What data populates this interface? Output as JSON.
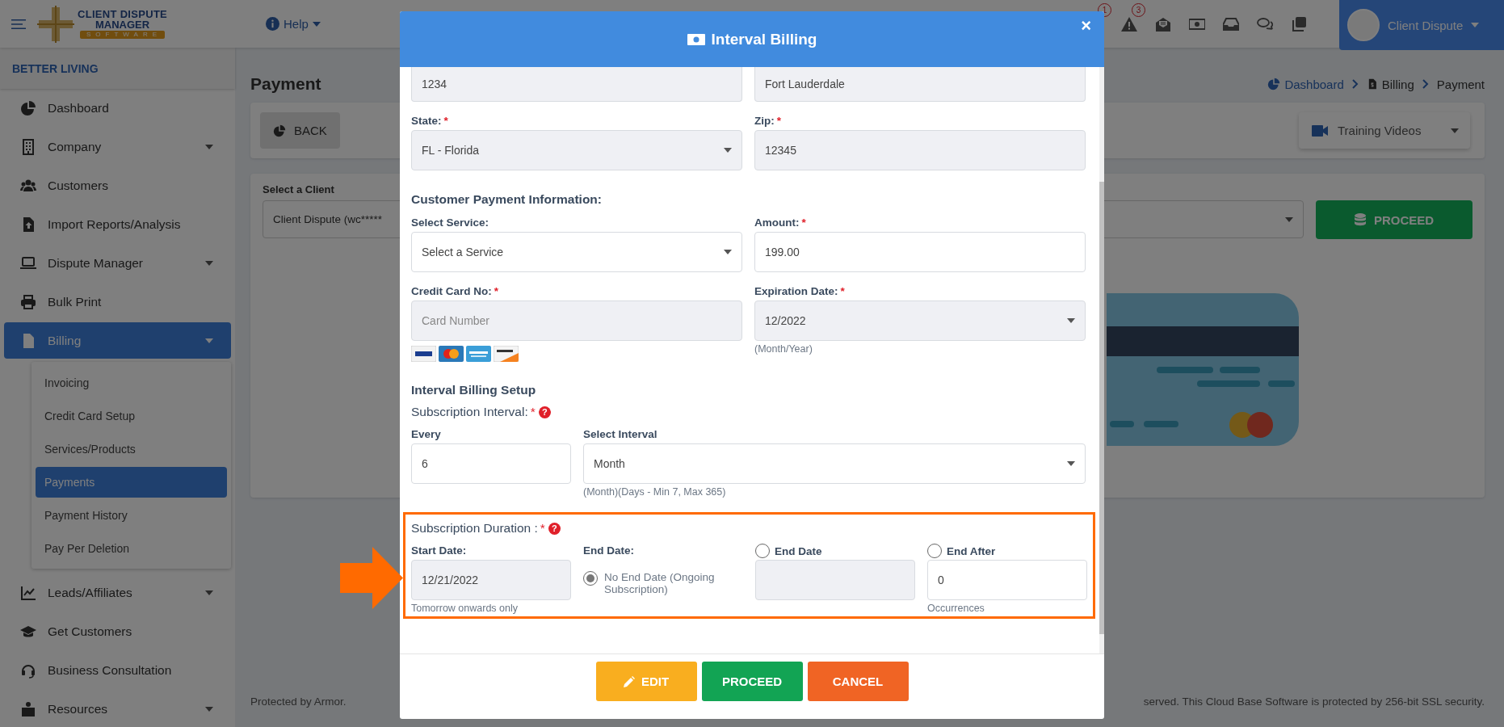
{
  "header": {
    "logo": {
      "line_1": "CLIENT DISPUTE",
      "line_2": "MANAGER",
      "tagline": "SOFTWARE"
    },
    "help": "Help",
    "icons": [
      {
        "kind": "covered",
        "badge": "1"
      },
      {
        "kind": "alert",
        "badge": "3"
      },
      {
        "kind": "mail"
      },
      {
        "kind": "money"
      },
      {
        "kind": "inbox"
      },
      {
        "kind": "chat"
      },
      {
        "kind": "copy"
      }
    ],
    "user": "Client Dispute"
  },
  "sidebar": {
    "org": "BETTER LIVING",
    "items": [
      {
        "label": "Dashboard",
        "has_submenu": false,
        "selected": false
      },
      {
        "label": "Company",
        "has_submenu": true,
        "selected": false
      },
      {
        "label": "Customers",
        "has_submenu": false,
        "selected": false
      },
      {
        "label": "Import Reports/Analysis",
        "has_submenu": false,
        "selected": false
      },
      {
        "label": "Dispute Manager",
        "has_submenu": true,
        "selected": false
      },
      {
        "label": "Bulk Print",
        "has_submenu": false,
        "selected": false
      },
      {
        "label": "Billing",
        "has_submenu": true,
        "selected": true,
        "children": [
          {
            "label": "Invoicing",
            "selected": false
          },
          {
            "label": "Credit Card Setup",
            "selected": false
          },
          {
            "label": "Services/Products",
            "selected": false
          },
          {
            "label": "Payments",
            "selected": true
          },
          {
            "label": "Payment History",
            "selected": false
          },
          {
            "label": "Pay Per Deletion",
            "selected": false
          }
        ]
      },
      {
        "label": "Leads/Affiliates",
        "has_submenu": true,
        "selected": false
      },
      {
        "label": "Get Customers",
        "has_submenu": false,
        "selected": false
      },
      {
        "label": "Business Consultation",
        "has_submenu": false,
        "selected": false
      },
      {
        "label": "Resources",
        "has_submenu": true,
        "selected": false
      }
    ]
  },
  "page": {
    "title": "Payment",
    "breadcrumb": [
      {
        "label": "Dashboard",
        "kind": "home"
      },
      {
        "label": "Billing",
        "kind": "section"
      },
      {
        "label": "Payment",
        "kind": "current"
      }
    ],
    "back": "BACK",
    "training": "Training Videos",
    "client": {
      "label": "Select a Client",
      "value": "Client Dispute (wc*****"
    },
    "proceed": "PROCEED",
    "footer_left": "Protected by Armor.",
    "footer_right": "served. This Cloud Base Software is protected by 256-bit SSL security."
  },
  "modal": {
    "title": "Interval Billing",
    "close": "×",
    "address": [
      {
        "kind": "input",
        "value": "1234",
        "disabled": true
      },
      {
        "kind": "input",
        "value": "Fort Lauderdale",
        "disabled": true
      }
    ],
    "location": [
      {
        "label": "State:",
        "mark": "*",
        "kind": "select",
        "value": "FL - Florida",
        "disabled": true
      },
      {
        "label": "Zip:",
        "mark": "*",
        "kind": "input",
        "value": "12345",
        "disabled": true
      }
    ],
    "payment": {
      "heading": "Customer Payment Information:",
      "fields": [
        {
          "label": "Select Service:",
          "kind": "select",
          "value": "Select a Service",
          "disabled": false
        },
        {
          "label": "Amount:",
          "mark": "*",
          "kind": "input",
          "value": "199.00",
          "disabled": false
        },
        {
          "label": "Credit Card No:",
          "mark": "*",
          "kind": "input",
          "placeholder": "Card Number",
          "disabled": true,
          "card_logos": true
        },
        {
          "label": "Expiration Date:",
          "mark": "*",
          "kind": "select",
          "value": "12/2022",
          "disabled": true,
          "hint": "(Month/Year)"
        }
      ]
    },
    "interval": {
      "heading": "Interval Billing Setup",
      "title": "Subscription Interval:",
      "mark": "*",
      "help": "?",
      "fields": [
        {
          "label": "Every",
          "kind": "input",
          "value": "6",
          "disabled": false
        },
        {
          "label": "Select Interval",
          "kind": "select",
          "value": "Month",
          "disabled": false,
          "hint": "(Month)(Days - Min 7, Max 365)"
        }
      ]
    },
    "duration": {
      "title": "Subscription Duration :",
      "mark": "*",
      "help": "?",
      "start": {
        "label": "Start Date:",
        "kind": "input",
        "value": "12/21/2022",
        "disabled": true,
        "hint": "Tomorrow onwards only"
      },
      "end_label": "End Date:",
      "options": [
        {
          "kind": "plain",
          "label": "No End Date (Ongoing Subscription)",
          "selected": true
        },
        {
          "kind": "with_field",
          "label": "End Date",
          "selected": false,
          "field": {
            "kind": "input",
            "disabled": true
          }
        },
        {
          "kind": "with_field",
          "label": "End After",
          "selected": false,
          "field": {
            "kind": "input",
            "value": "0",
            "disabled": false,
            "hint": "Occurrences"
          }
        }
      ]
    },
    "buttons": [
      {
        "label": "EDIT",
        "kind": "edit"
      },
      {
        "label": "PROCEED",
        "kind": "proceed"
      },
      {
        "label": "CANCEL",
        "kind": "cancel"
      }
    ]
  }
}
